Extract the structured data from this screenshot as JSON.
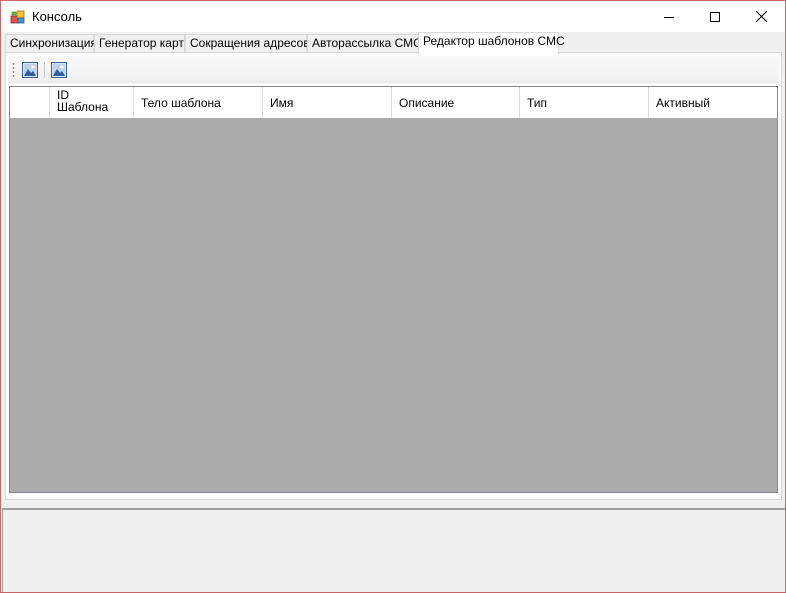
{
  "window": {
    "title": "Консоль"
  },
  "tabs": [
    {
      "label": "Синхронизация",
      "active": false
    },
    {
      "label": "Генератор карт",
      "active": false
    },
    {
      "label": "Сокращения адресов",
      "active": false
    },
    {
      "label": "Авторассылка СМС",
      "active": false
    },
    {
      "label": "Редактор шаблонов СМС",
      "active": true
    }
  ],
  "toolbar": {
    "buttons": [
      {
        "icon": "image-icon"
      },
      {
        "icon": "image-icon"
      }
    ]
  },
  "grid": {
    "columns": [
      {
        "label": "ID\nШаблона"
      },
      {
        "label": "Тело шаблона"
      },
      {
        "label": "Имя"
      },
      {
        "label": "Описание"
      },
      {
        "label": "Тип"
      },
      {
        "label": "Активный"
      }
    ],
    "rows": []
  },
  "colors": {
    "grid_empty_background": "#ababab",
    "window_border": "#c86464"
  }
}
